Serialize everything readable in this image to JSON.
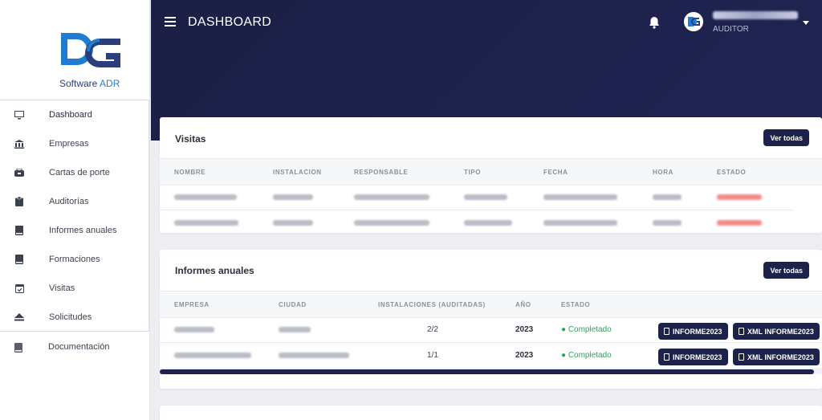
{
  "brand": {
    "caption_prefix": "Software ",
    "caption_accent": "ADR",
    "accent": "#1f7cd2",
    "dark": "#2a3e7a"
  },
  "sidebar": {
    "items": [
      {
        "label": "Dashboard",
        "icon": "monitor-icon"
      },
      {
        "label": "Empresas",
        "icon": "bank-icon"
      },
      {
        "label": "Cartas de porte",
        "icon": "truck-icon"
      },
      {
        "label": "Auditorías",
        "icon": "clipboard-icon"
      },
      {
        "label": "Informes anuales",
        "icon": "book-icon"
      },
      {
        "label": "Formaciones",
        "icon": "book-icon"
      },
      {
        "label": "Visitas",
        "icon": "calendar-check-icon"
      },
      {
        "label": "Solicitudes",
        "icon": "eject-icon"
      }
    ],
    "doc_label": "Documentación"
  },
  "header": {
    "title": "DASHBOARD",
    "user_role": "AUDITOR",
    "bg": "#1c1f45"
  },
  "visitas": {
    "title": "Visitas",
    "button": "Ver todas",
    "columns": [
      "NOMBRE",
      "INSTALACION",
      "RESPONSABLE",
      "TIPO",
      "FECHA",
      "HORA",
      "ESTADO"
    ]
  },
  "informes": {
    "title": "Informes anuales",
    "button": "Ver todas",
    "columns": [
      "EMPRESA",
      "CIUDAD",
      "INSTALACIONES (AUDITADAS)",
      "AÑO",
      "ESTADO"
    ],
    "rows": [
      {
        "instalaciones": "2/2",
        "anio": "2023",
        "estado": "● Completado",
        "btn_informe": "INFORME2023",
        "btn_xml": "XML INFORME2023"
      },
      {
        "instalaciones": "1/1",
        "anio": "2023",
        "estado": "● Completado",
        "btn_informe": "INFORME2023",
        "btn_xml": "XML INFORME2023"
      }
    ]
  }
}
